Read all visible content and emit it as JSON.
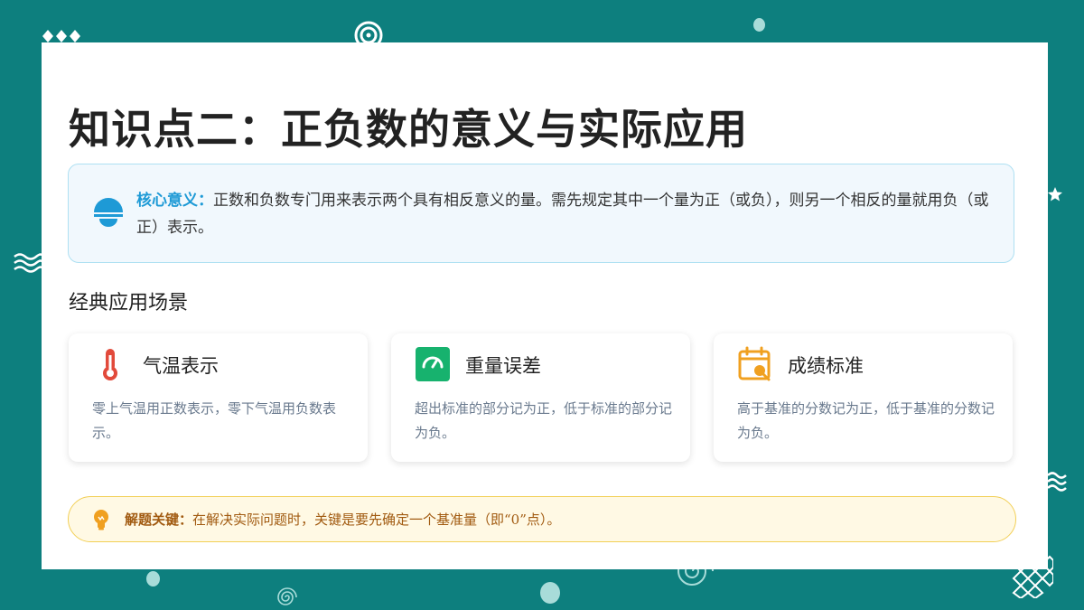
{
  "title": "知识点二：正负数的意义与实际应用",
  "core": {
    "label": "核心意义：",
    "text": "正数和负数专门用来表示两个具有相反意义的量。需先规定其中一个量为正（或负），则另一个相反的量就用负（或正）表示。",
    "icon": "half-circle-icon",
    "accent_color": "#1e9ad6"
  },
  "section_title": "经典应用场景",
  "cards": [
    {
      "title": "气温表示",
      "desc": "零上气温用正数表示，零下气温用负数表示。",
      "icon": "thermometer-icon",
      "color": "#e24a3b"
    },
    {
      "title": "重量误差",
      "desc": "超出标准的部分记为正，低于标准的部分记为负。",
      "icon": "gauge-icon",
      "color": "#17b26e"
    },
    {
      "title": "成绩标准",
      "desc": "高于基准的分数记为正，低于基准的分数记为负。",
      "icon": "calendar-search-icon",
      "color": "#f0a020"
    }
  ],
  "key": {
    "label": "解题关键：",
    "text": "在解决实际问题时，关键是要先确定一个基准量（即“0”点）。",
    "icon": "lightbulb-icon",
    "color": "#a15a10"
  },
  "background_color": "#0d7f7e"
}
